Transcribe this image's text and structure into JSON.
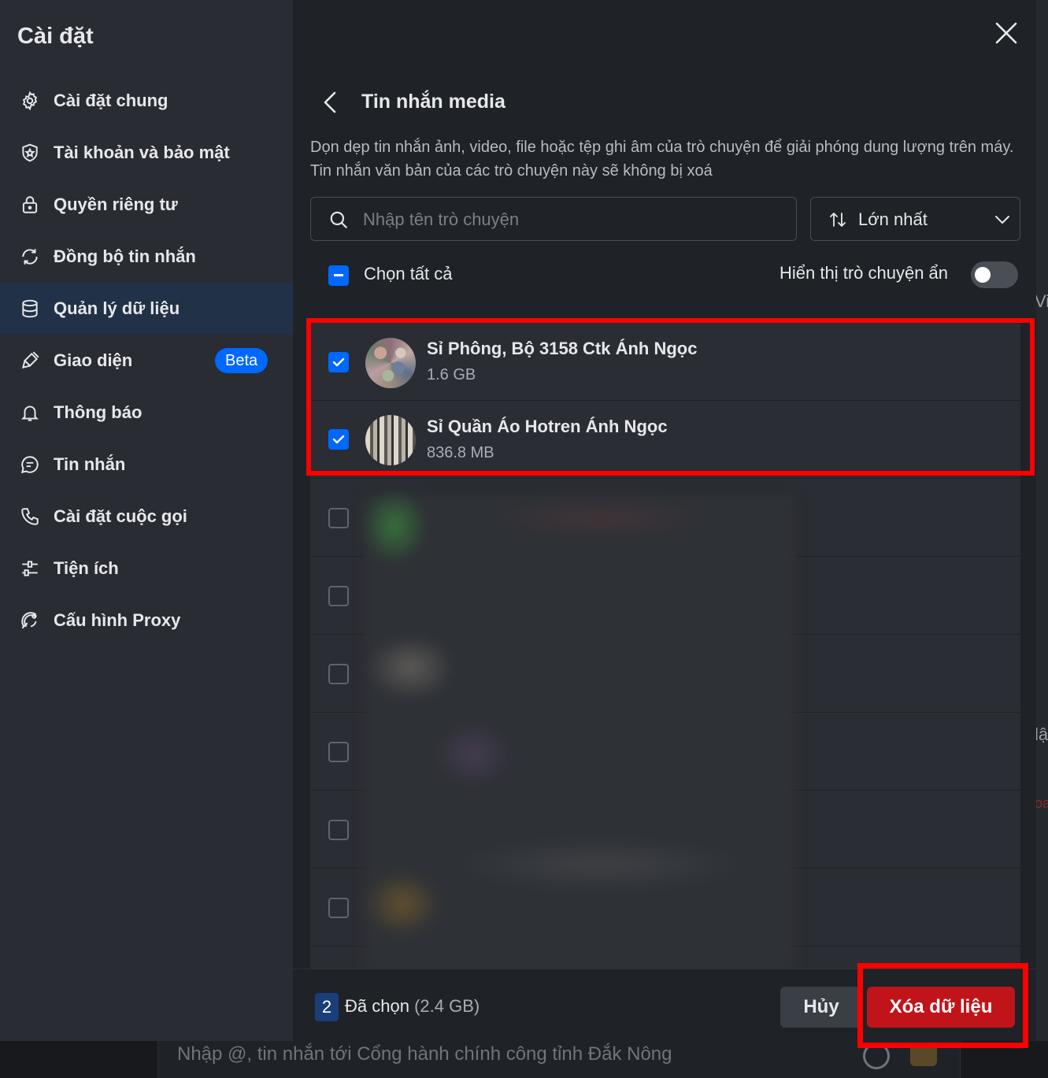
{
  "sidebar": {
    "title": "Cài đặt",
    "items": [
      {
        "label": "Cài đặt chung",
        "icon": "gear-icon"
      },
      {
        "label": "Tài khoản và bảo mật",
        "icon": "shield-icon"
      },
      {
        "label": "Quyền riêng tư",
        "icon": "lock-icon"
      },
      {
        "label": "Đồng bộ tin nhắn",
        "icon": "sync-icon"
      },
      {
        "label": "Quản lý dữ liệu",
        "icon": "database-icon",
        "active": true
      },
      {
        "label": "Giao diện",
        "icon": "brush-icon",
        "badge": "Beta"
      },
      {
        "label": "Thông báo",
        "icon": "bell-icon"
      },
      {
        "label": "Tin nhắn",
        "icon": "chat-icon"
      },
      {
        "label": "Cài đặt cuộc gọi",
        "icon": "phone-icon"
      },
      {
        "label": "Tiện ích",
        "icon": "sliders-icon"
      },
      {
        "label": "Cấu hình Proxy",
        "icon": "proxy-icon"
      }
    ]
  },
  "main": {
    "title": "Tin nhắn media",
    "description": "Dọn dẹp tin nhắn ảnh, video, file hoặc tệp ghi âm của trò chuyện để giải phóng dung lượng trên máy. Tin nhắn văn bản của các trò chuyện này sẽ không bị xoá",
    "search_placeholder": "Nhập tên trò chuyện",
    "sort_label": "Lớn nhất",
    "select_all_label": "Chọn tất cả",
    "show_hidden_label": "Hiển thị trò chuyện ẩn",
    "show_hidden_on": false
  },
  "conversations": [
    {
      "name": "Sỉ Phông, Bộ 3158 Ctk Ánh Ngọc",
      "size": "1.6 GB",
      "checked": true
    },
    {
      "name": "Sỉ Quần Áo Hotren Ánh Ngọc",
      "size": "836.8 MB",
      "checked": true
    },
    {
      "name": "",
      "size": "",
      "checked": false
    },
    {
      "name": "",
      "size": "",
      "checked": false
    },
    {
      "name": "",
      "size": "",
      "checked": false
    },
    {
      "name": "",
      "size": "",
      "checked": false
    },
    {
      "name": "",
      "size": "",
      "checked": false
    },
    {
      "name": "",
      "size": "",
      "checked": false
    }
  ],
  "footer": {
    "selected_count": "2",
    "selected_label": "Đã chọn",
    "selected_size": "(2.4 GB)",
    "cancel_label": "Hủy",
    "delete_label": "Xóa dữ liệu"
  },
  "background": {
    "composer_placeholder": "Nhập @, tin nhắn tới Cổng hành chính công tỉnh Đắk Nông",
    "fragments": [
      "Vi",
      "lậ",
      "oa"
    ]
  },
  "colors": {
    "accent": "#0068ff",
    "danger": "#c0141a",
    "highlight": "#ff0000"
  }
}
